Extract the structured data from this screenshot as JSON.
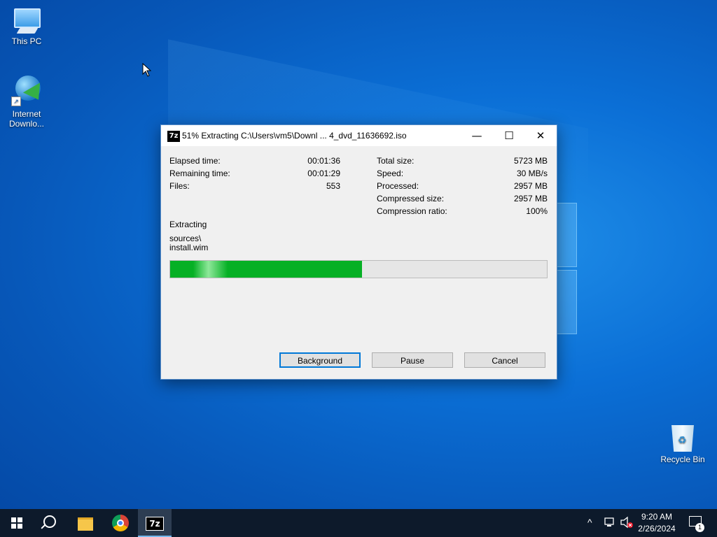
{
  "desktop": {
    "icons": [
      {
        "label": "This PC"
      },
      {
        "label": "Internet Downlo..."
      },
      {
        "label": "Recycle Bin"
      }
    ]
  },
  "dialog": {
    "title": "51% Extracting C:\\Users\\vm5\\Downl ... 4_dvd_11636692.iso",
    "app_icon": "7z",
    "left_stats": [
      {
        "label": "Elapsed time:",
        "value": "00:01:36"
      },
      {
        "label": "Remaining time:",
        "value": "00:01:29"
      },
      {
        "label": "Files:",
        "value": "553"
      }
    ],
    "right_stats": [
      {
        "label": "Total size:",
        "value": "5723 MB"
      },
      {
        "label": "Speed:",
        "value": "30 MB/s"
      },
      {
        "label": "Processed:",
        "value": "2957 MB"
      },
      {
        "label": "Compressed size:",
        "value": "2957 MB"
      },
      {
        "label": "Compression ratio:",
        "value": "100%"
      }
    ],
    "operation": "Extracting",
    "current_path": "sources\\",
    "current_file": "install.wim",
    "progress_percent": 51,
    "buttons": {
      "background": "Background",
      "pause": "Pause",
      "cancel": "Cancel"
    },
    "window_controls": {
      "minimize": "—",
      "maximize": "☐",
      "close": "✕"
    }
  },
  "taskbar": {
    "pinned": [
      "start-icon",
      "search-icon",
      "file-explorer-icon",
      "chrome-icon",
      "7zip-icon"
    ],
    "active": "7zip-icon",
    "tray_chevron": "^",
    "clock": {
      "time": "9:20 AM",
      "date": "2/26/2024"
    },
    "notifications_count": "1"
  },
  "colors": {
    "progress_fill": "#06b025",
    "accent": "#0078d7"
  }
}
